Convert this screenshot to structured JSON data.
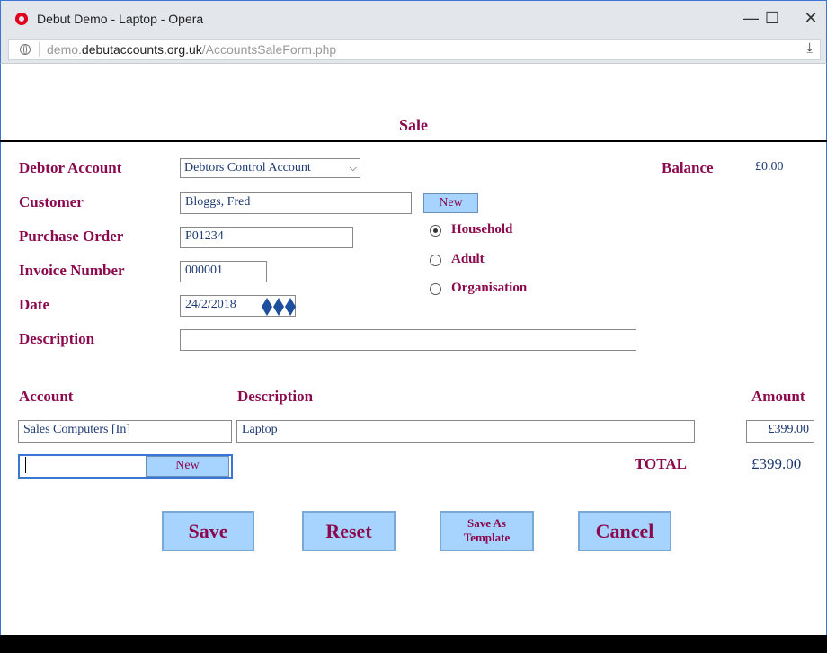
{
  "window": {
    "title": "Debut Demo - Laptop - Opera",
    "minimize": "—",
    "maximize": "☐",
    "close": "✕"
  },
  "address_bar": {
    "url_prefix": "demo.",
    "url_host": "debutaccounts.org.uk",
    "url_path": "/AccountsSaleForm.php",
    "download_icon": "⤓"
  },
  "page": {
    "title": "Sale"
  },
  "form": {
    "debtor_account_label": "Debtor Account",
    "debtor_account_value": "Debtors Control Account",
    "balance_label": "Balance",
    "balance_value": "£0.00",
    "customer_label": "Customer",
    "customer_value": "Bloggs, Fred",
    "customer_new_button": "New",
    "purchase_order_label": "Purchase Order",
    "purchase_order_value": "P01234",
    "invoice_number_label": "Invoice Number",
    "invoice_number_value": "000001",
    "date_label": "Date",
    "date_value": "24/2/2018",
    "description_label": "Description",
    "description_value": "",
    "customer_type_options": [
      "Household",
      "Adult",
      "Organisation"
    ],
    "customer_type_selected": "Household"
  },
  "lines": {
    "headers": {
      "account": "Account",
      "description": "Description",
      "amount": "Amount"
    },
    "rows": [
      {
        "account": "Sales Computers [In]",
        "description": "Laptop",
        "amount": "£399.00"
      }
    ],
    "new_account_value": "",
    "new_button": "New",
    "total_label": "TOTAL",
    "total_value": "£399.00"
  },
  "actions": {
    "save": "Save",
    "reset": "Reset",
    "save_as_template_line1": "Save As",
    "save_as_template_line2": "Template",
    "cancel": "Cancel"
  },
  "colors": {
    "label": "#8b0a4e",
    "value": "#1e3a72",
    "button_bg": "#a6d4ff",
    "opera_red": "#e0001b"
  }
}
